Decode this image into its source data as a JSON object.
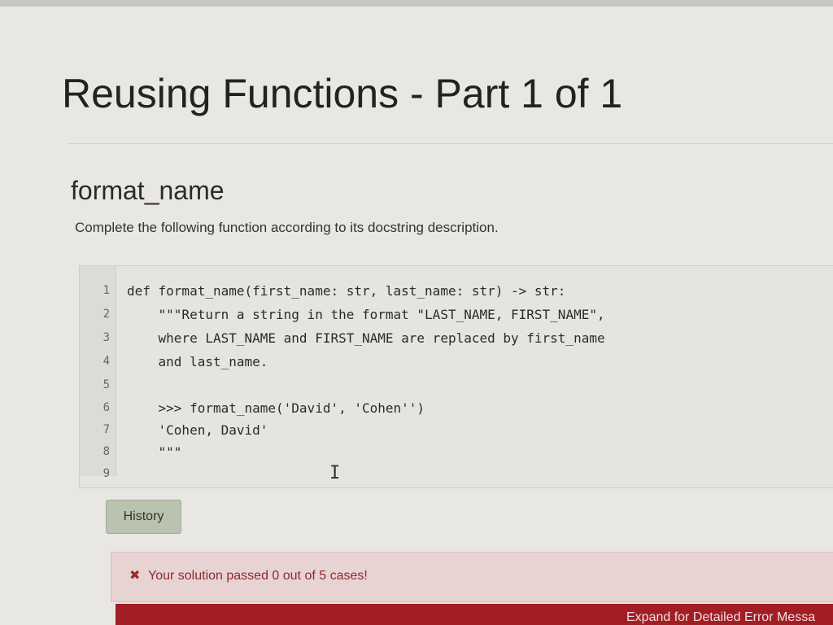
{
  "page": {
    "title": "Reusing Functions - Part 1 of 1"
  },
  "exercise": {
    "name": "format_name",
    "instructions": "Complete the following function according to its docstring description."
  },
  "editor": {
    "lines": [
      {
        "num": "1",
        "code": "def format_name(first_name: str, last_name: str) -> str:"
      },
      {
        "num": "2",
        "code": "    \"\"\"Return a string in the format \"LAST_NAME, FIRST_NAME\","
      },
      {
        "num": "3",
        "code": "    where LAST_NAME and FIRST_NAME are replaced by first_name"
      },
      {
        "num": "4",
        "code": "    and last_name."
      },
      {
        "num": "5",
        "code": ""
      },
      {
        "num": "6",
        "code": "    >>> format_name('David', 'Cohen'')"
      },
      {
        "num": "7",
        "code": "    'Cohen, David'"
      },
      {
        "num": "8",
        "code": "    \"\"\""
      },
      {
        "num": "9",
        "code": ""
      }
    ],
    "cursor_glyph": "I"
  },
  "buttons": {
    "history_label": "History"
  },
  "result": {
    "icon": "x-mark-icon",
    "icon_glyph": "✖",
    "message": "Your solution passed 0 out of 5 cases!"
  },
  "error_bar": {
    "label": "Expand for Detailed Error Messa"
  },
  "colors": {
    "error_bar": "#a11e24",
    "result_bg": "#e8d3d3",
    "history_button": "#b9c3ae"
  }
}
